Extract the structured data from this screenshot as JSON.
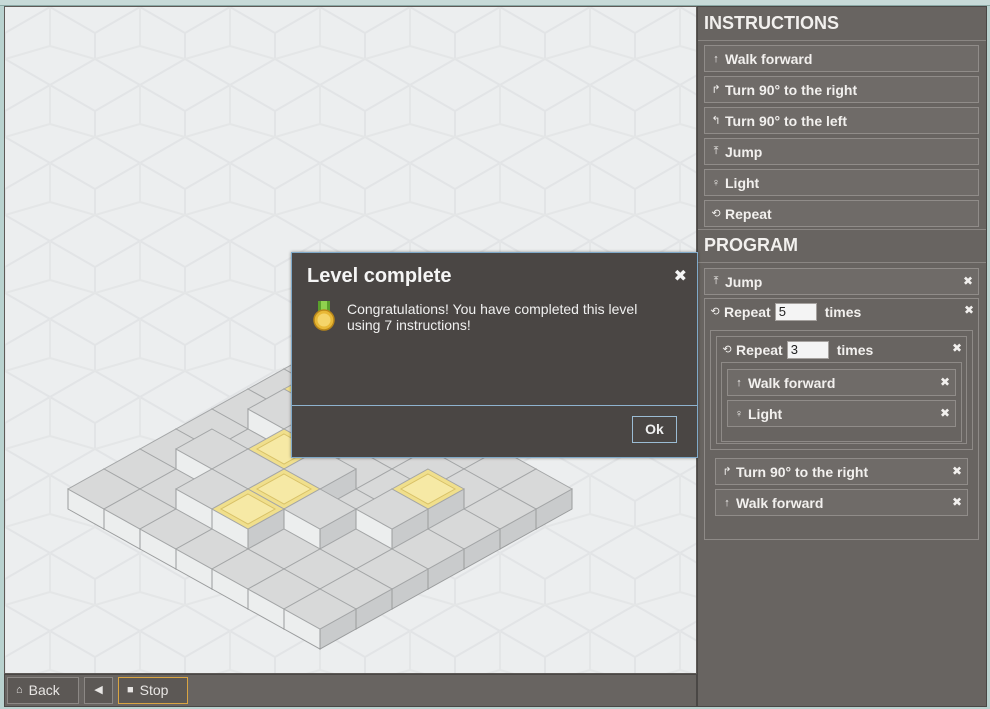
{
  "instructions_panel": {
    "title": "INSTRUCTIONS",
    "items": [
      {
        "icon": "arrow-up-icon",
        "glyph": "🠕",
        "label": "Walk forward"
      },
      {
        "icon": "turn-right-icon",
        "glyph": "↱",
        "label": "Turn 90° to the right"
      },
      {
        "icon": "turn-left-icon",
        "glyph": "↰",
        "label": "Turn 90° to the left"
      },
      {
        "icon": "jump-icon",
        "glyph": "⤒",
        "label": "Jump"
      },
      {
        "icon": "bulb-icon",
        "glyph": "♀",
        "label": "Light"
      },
      {
        "icon": "repeat-icon",
        "glyph": "⟲",
        "label": "Repeat"
      }
    ]
  },
  "program_panel": {
    "title": "PROGRAM",
    "jump_label": "Jump",
    "repeat_outer": {
      "label": "Repeat",
      "count": "5",
      "suffix": "times"
    },
    "repeat_inner": {
      "label": "Repeat",
      "count": "3",
      "suffix": "times"
    },
    "walk_label": "Walk forward",
    "light_label": "Light",
    "turn_right_label": "Turn 90° to the right",
    "walk_label_2": "Walk forward",
    "remove_glyph": "✖"
  },
  "dialog": {
    "title": "Level complete",
    "close_glyph": "✖",
    "message": "Congratulations! You have completed this level using 7 instructions!",
    "ok_label": "Ok"
  },
  "bottom_bar": {
    "back_label": "Back",
    "stop_label": "Stop"
  },
  "colors": {
    "panel": "#686461",
    "dialog": "#4a4644",
    "tile_lit": "#f0df8c",
    "tile_top": "#d8d9d9"
  }
}
